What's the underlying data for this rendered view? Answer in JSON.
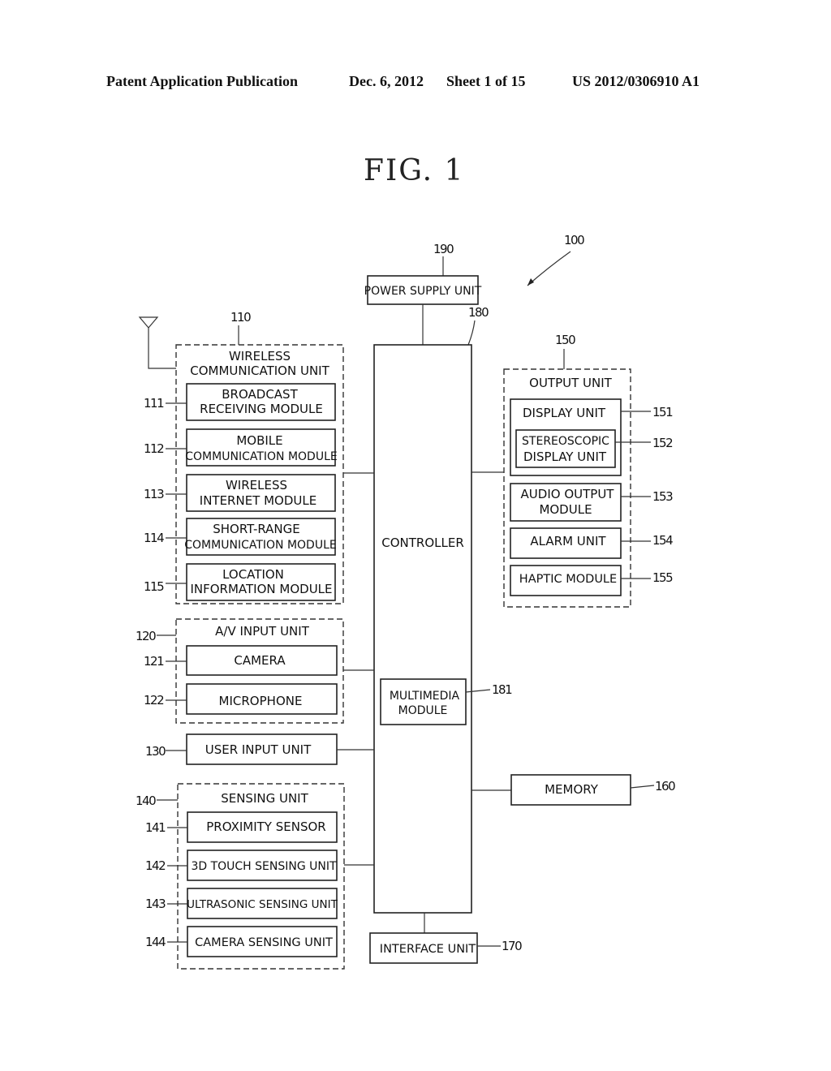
{
  "header": {
    "publication": "Patent Application Publication",
    "date": "Dec. 6, 2012",
    "sheet": "Sheet 1 of 15",
    "number": "US 2012/0306910 A1"
  },
  "figure": {
    "title": "FIG. 1"
  },
  "diagram": {
    "device_ref": "100",
    "power_supply": {
      "ref": "190",
      "label": "POWER SUPPLY UNIT"
    },
    "controller": {
      "ref": "180",
      "label": "CONTROLLER",
      "multimedia": {
        "ref": "181",
        "line1": "MULTIMEDIA",
        "line2": "MODULE"
      }
    },
    "wireless": {
      "ref": "110",
      "line1": "WIRELESS",
      "line2": "COMMUNICATION UNIT",
      "modules": [
        {
          "ref": "111",
          "line1": "BROADCAST",
          "line2": "RECEIVING MODULE"
        },
        {
          "ref": "112",
          "line1": "MOBILE",
          "line2": "COMMUNICATION MODULE"
        },
        {
          "ref": "113",
          "line1": "WIRELESS",
          "line2": "INTERNET MODULE"
        },
        {
          "ref": "114",
          "line1": "SHORT-RANGE",
          "line2": "COMMUNICATION MODULE"
        },
        {
          "ref": "115",
          "line1": "LOCATION",
          "line2": "INFORMATION MODULE"
        }
      ]
    },
    "av_input": {
      "ref": "120",
      "label": "A/V INPUT UNIT",
      "modules": [
        {
          "ref": "121",
          "label": "CAMERA"
        },
        {
          "ref": "122",
          "label": "MICROPHONE"
        }
      ]
    },
    "user_input": {
      "ref": "130",
      "label": "USER INPUT UNIT"
    },
    "sensing": {
      "ref": "140",
      "label": "SENSING UNIT",
      "modules": [
        {
          "ref": "141",
          "label": "PROXIMITY SENSOR"
        },
        {
          "ref": "142",
          "label": "3D TOUCH SENSING UNIT"
        },
        {
          "ref": "143",
          "label": "ULTRASONIC SENSING UNIT"
        },
        {
          "ref": "144",
          "label": "CAMERA SENSING UNIT"
        }
      ]
    },
    "output": {
      "ref": "150",
      "label": "OUTPUT UNIT",
      "display": {
        "ref": "151",
        "label": "DISPLAY UNIT"
      },
      "stereo": {
        "ref": "152",
        "line1": "STEREOSCOPIC",
        "line2": "DISPLAY UNIT"
      },
      "audio": {
        "ref": "153",
        "line1": "AUDIO OUTPUT",
        "line2": "MODULE"
      },
      "alarm": {
        "ref": "154",
        "label": "ALARM UNIT"
      },
      "haptic": {
        "ref": "155",
        "label": "HAPTIC MODULE"
      }
    },
    "memory": {
      "ref": "160",
      "label": "MEMORY"
    },
    "interface": {
      "ref": "170",
      "label": "INTERFACE UNIT"
    }
  }
}
